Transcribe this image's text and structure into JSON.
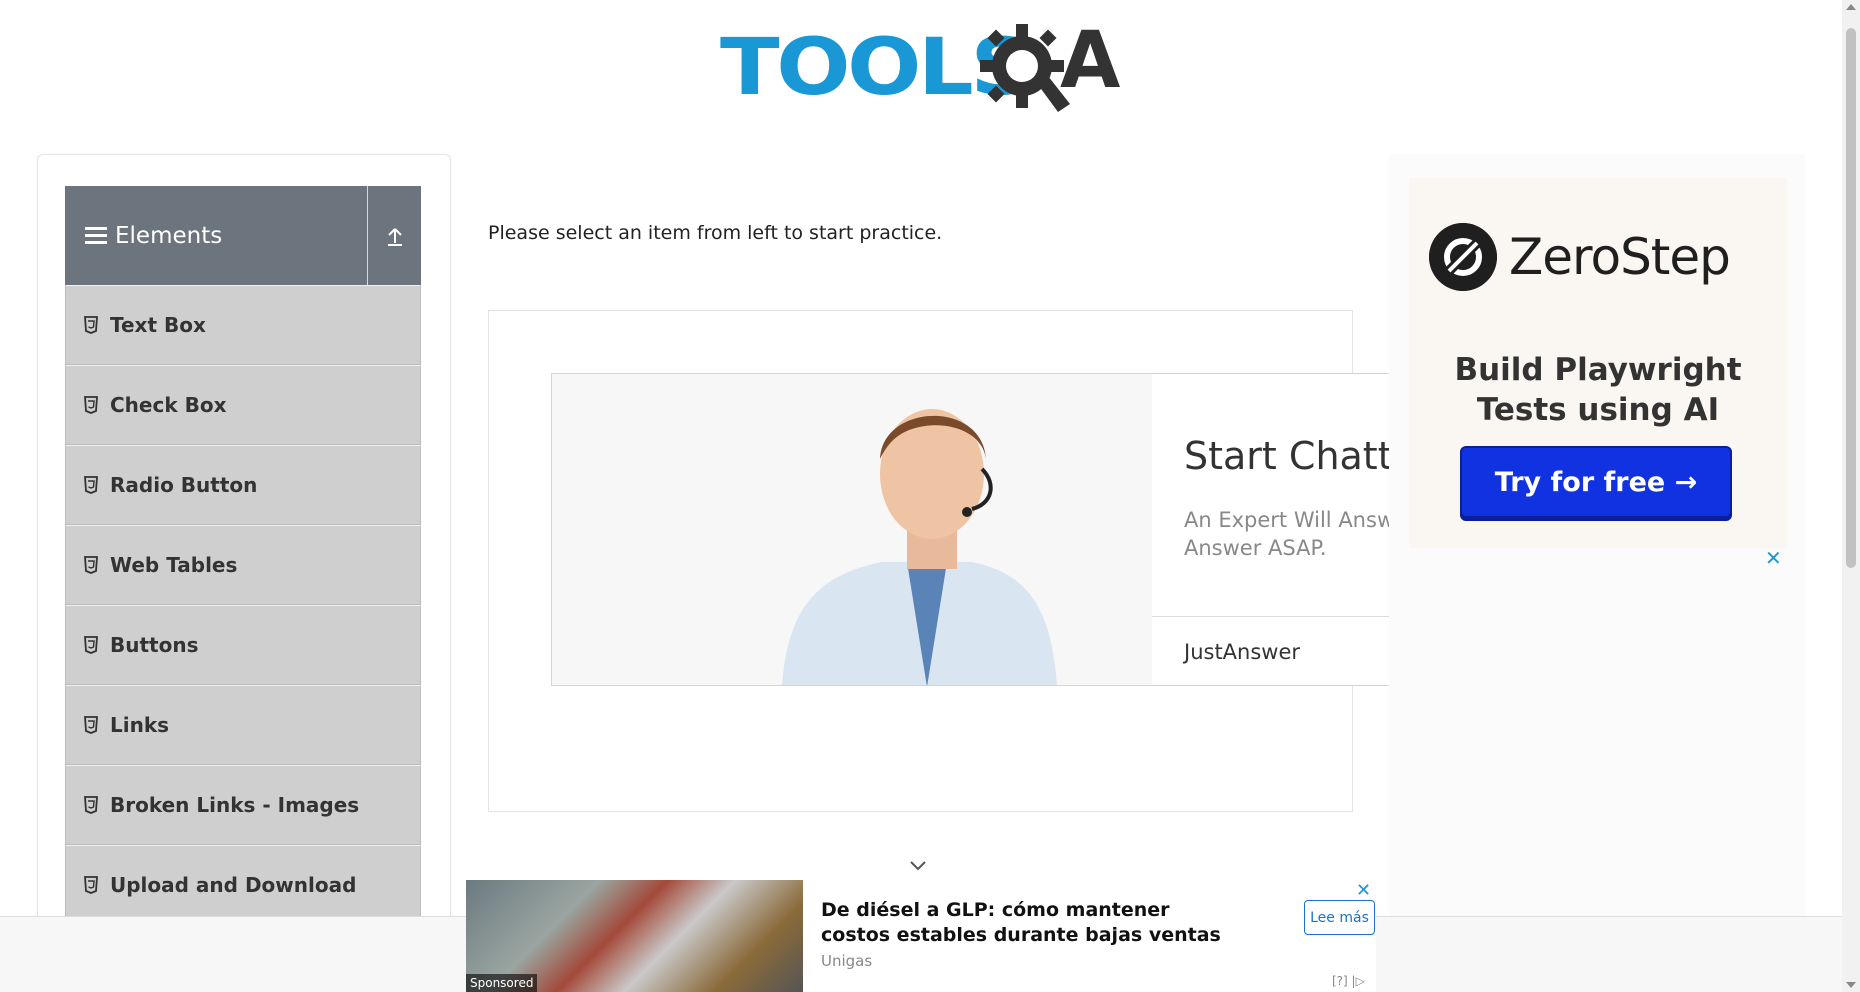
{
  "header": {
    "logo_text": "TOOLS",
    "logo_suffix": "A"
  },
  "sidebar": {
    "group_title": "Elements",
    "items": [
      {
        "label": "Text Box"
      },
      {
        "label": "Check Box"
      },
      {
        "label": "Radio Button"
      },
      {
        "label": "Web Tables"
      },
      {
        "label": "Buttons"
      },
      {
        "label": "Links"
      },
      {
        "label": "Broken Links - Images"
      },
      {
        "label": "Upload and Download"
      }
    ]
  },
  "main": {
    "instruction": "Please select an item from left to start practice."
  },
  "chat_ad": {
    "title": "Start Chattin",
    "subtitle": "An Expert Will Answe an Answer ASAP.",
    "brand": "JustAnswer"
  },
  "right_ad": {
    "brand": "ZeroStep",
    "tagline_line1": "Build Playwright",
    "tagline_line2": "Tests using AI",
    "cta": "Try for free →",
    "close": "✕"
  },
  "bottom_ad": {
    "sponsored": "Sponsored",
    "title": "De diésel a GLP: cómo mantener costos estables durante bajas ventas",
    "brand": "Unigas",
    "cta": "Lee más",
    "close": "✕",
    "info": "[?] |▷"
  },
  "colors": {
    "brand_blue": "#1a98d6",
    "group_header": "#6c757d",
    "menu_item": "#cfcfcf",
    "cta_blue": "#1132e0"
  }
}
